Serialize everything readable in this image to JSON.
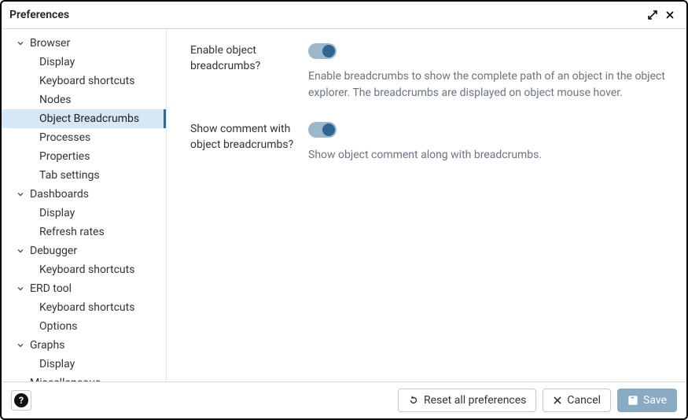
{
  "header": {
    "title": "Preferences"
  },
  "sidebar": {
    "groups": [
      {
        "label": "Browser",
        "children": [
          {
            "label": "Display"
          },
          {
            "label": "Keyboard shortcuts"
          },
          {
            "label": "Nodes"
          },
          {
            "label": "Object Breadcrumbs",
            "selected": true
          },
          {
            "label": "Processes"
          },
          {
            "label": "Properties"
          },
          {
            "label": "Tab settings"
          }
        ]
      },
      {
        "label": "Dashboards",
        "children": [
          {
            "label": "Display"
          },
          {
            "label": "Refresh rates"
          }
        ]
      },
      {
        "label": "Debugger",
        "children": [
          {
            "label": "Keyboard shortcuts"
          }
        ]
      },
      {
        "label": "ERD tool",
        "children": [
          {
            "label": "Keyboard shortcuts"
          },
          {
            "label": "Options"
          }
        ]
      },
      {
        "label": "Graphs",
        "children": [
          {
            "label": "Display"
          }
        ]
      },
      {
        "label": "Miscellaneous",
        "children": []
      }
    ]
  },
  "content": {
    "prefs": [
      {
        "label": "Enable object breadcrumbs?",
        "value": true,
        "description": "Enable breadcrumbs to show the complete path of an object in the object explorer. The breadcrumbs are displayed on object mouse hover."
      },
      {
        "label": "Show comment with object breadcrumbs?",
        "value": true,
        "description": "Show object comment along with breadcrumbs."
      }
    ]
  },
  "footer": {
    "reset_label": "Reset all preferences",
    "cancel_label": "Cancel",
    "save_label": "Save"
  }
}
